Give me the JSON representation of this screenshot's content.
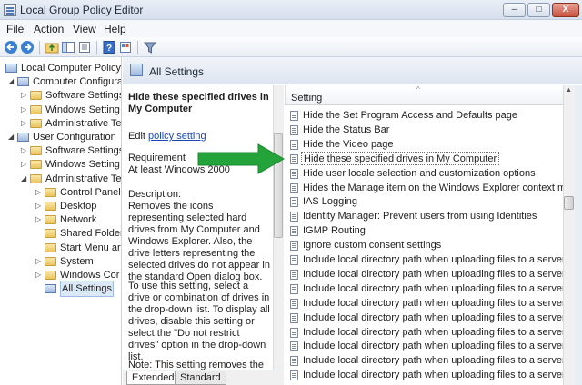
{
  "window": {
    "title": "Local Group Policy Editor",
    "minimize_glyph": "–",
    "maximize_glyph": "□",
    "close_glyph": "X"
  },
  "menu": [
    "File",
    "Action",
    "View",
    "Help"
  ],
  "toolbar_icons": [
    "back-icon",
    "forward-icon",
    "up-folder-icon",
    "show-hide-tree-icon",
    "export-list-icon",
    "help-icon",
    "properties-icon",
    "filter-icon"
  ],
  "tree": [
    {
      "label": "Local Computer Policy",
      "level": 0,
      "icon": "policy"
    },
    {
      "label": "Computer Configura",
      "level": 1,
      "icon": "policy",
      "expander": "◢"
    },
    {
      "label": "Software Settings",
      "level": 2,
      "icon": "folder",
      "expander": "▷"
    },
    {
      "label": "Windows Setting",
      "level": 2,
      "icon": "folder",
      "expander": "▷"
    },
    {
      "label": "Administrative Te",
      "level": 2,
      "icon": "folder",
      "expander": "▷"
    },
    {
      "label": "User Configuration",
      "level": 1,
      "icon": "policy",
      "expander": "◢"
    },
    {
      "label": "Software Settings",
      "level": 2,
      "icon": "folder",
      "expander": "▷"
    },
    {
      "label": "Windows Setting",
      "level": 2,
      "icon": "folder",
      "expander": "▷"
    },
    {
      "label": "Administrative Te",
      "level": 2,
      "icon": "folder",
      "expander": "◢"
    },
    {
      "label": "Control Panel",
      "level": 3,
      "icon": "folder",
      "expander": "▷"
    },
    {
      "label": "Desktop",
      "level": 3,
      "icon": "folder",
      "expander": "▷"
    },
    {
      "label": "Network",
      "level": 3,
      "icon": "folder",
      "expander": "▷"
    },
    {
      "label": "Shared Folder",
      "level": 3,
      "icon": "folder",
      "expander": ""
    },
    {
      "label": "Start Menu ar",
      "level": 3,
      "icon": "folder",
      "expander": ""
    },
    {
      "label": "System",
      "level": 3,
      "icon": "folder",
      "expander": "▷"
    },
    {
      "label": "Windows Cor",
      "level": 3,
      "icon": "folder",
      "expander": "▷"
    },
    {
      "label": "All Settings",
      "level": 3,
      "icon": "policy",
      "expander": "",
      "selected": true
    }
  ],
  "center": {
    "title": "All Settings"
  },
  "description": {
    "title": "Hide these specified drives in My Computer",
    "edit_prefix": "Edit ",
    "edit_link": "policy setting",
    "requirements_label": "Requirement",
    "requirements_value": "At least Windows 2000",
    "description_label": "Description:",
    "paragraph1": "Removes the icons representing selected hard drives from My Computer and Windows Explorer. Also, the drive letters representing the selected drives do not appear in the standard Open dialog box.",
    "paragraph2": "To use this setting, select a drive or combination of drives in the drop-down list. To display all drives, disable this setting or select the \"Do not restrict drives\" option in the drop-down list.",
    "paragraph3": "Note: This setting removes the"
  },
  "tabs": [
    "Extended",
    "Standard"
  ],
  "list": {
    "column": "Setting",
    "rows": [
      "Hide the Set Program Access and Defaults page",
      "Hide the Status Bar",
      "Hide the Video page",
      "Hide these specified drives in My Computer",
      "Hide user locale selection and customization options",
      "Hides the Manage item on the Windows Explorer context m...",
      "IAS Logging",
      "Identity Manager: Prevent users from using Identities",
      "IGMP Routing",
      "Ignore custom consent settings",
      "Include local directory path when uploading files to a server",
      "Include local directory path when uploading files to a server",
      "Include local directory path when uploading files to a server",
      "Include local directory path when uploading files to a server",
      "Include local directory path when uploading files to a server",
      "Include local directory path when uploading files to a server",
      "Include local directory path when uploading files to a server",
      "Include local directory path when uploading files to a server",
      "Include local directory path when uploading files to a server"
    ],
    "selected_index": 3
  },
  "colors": {
    "arrow": "#23a33a",
    "link": "#1a48b7",
    "selection": "#dbe8f8"
  }
}
